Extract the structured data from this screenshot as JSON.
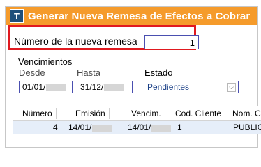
{
  "window": {
    "icon_glyph": "T",
    "title": "Generar Nueva Remesa de Efectos a Cobrar"
  },
  "form": {
    "numero_label": "Número de la nueva remesa",
    "numero_value": "1",
    "vencimientos_label": "Vencimientos",
    "desde_label": "Desde",
    "desde_value": "01/01/",
    "hasta_label": "Hasta",
    "hasta_value": "31/12/",
    "estado_label": "Estado",
    "estado_value": "Pendientes",
    "chevron_glyph": "⌵"
  },
  "table": {
    "columns": [
      "Número",
      "Emisión",
      "Vencim.",
      "Cod. Cliente",
      "Nom. Cli"
    ],
    "rows": [
      {
        "numero": "4",
        "emision": "14/01/",
        "vencim": "14/01/",
        "cod_cliente": "1",
        "nom_cliente": "PUBLICO"
      }
    ]
  },
  "colors": {
    "title_bar": "#f59b2b",
    "highlight_border": "#e0191f",
    "input_border": "#4a4fb0",
    "selected_row": "#e6eef9"
  },
  "icons": [
    "app-icon",
    "chevron-down-icon"
  ]
}
